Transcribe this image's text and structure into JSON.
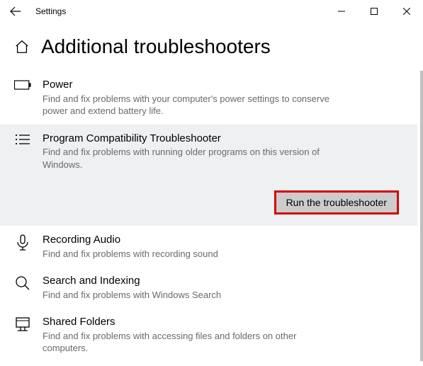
{
  "window": {
    "app_title": "Settings"
  },
  "header": {
    "title": "Additional troubleshooters"
  },
  "items": [
    {
      "name": "Power",
      "desc": "Find and fix problems with your computer's power settings to conserve power and extend battery life."
    },
    {
      "name": "Program Compatibility Troubleshooter",
      "desc": "Find and fix problems with running older programs on this version of Windows.",
      "run_label": "Run the troubleshooter"
    },
    {
      "name": "Recording Audio",
      "desc": "Find and fix problems with recording sound"
    },
    {
      "name": "Search and Indexing",
      "desc": "Find and fix problems with Windows Search"
    },
    {
      "name": "Shared Folders",
      "desc": "Find and fix problems with accessing files and folders on other computers."
    }
  ]
}
